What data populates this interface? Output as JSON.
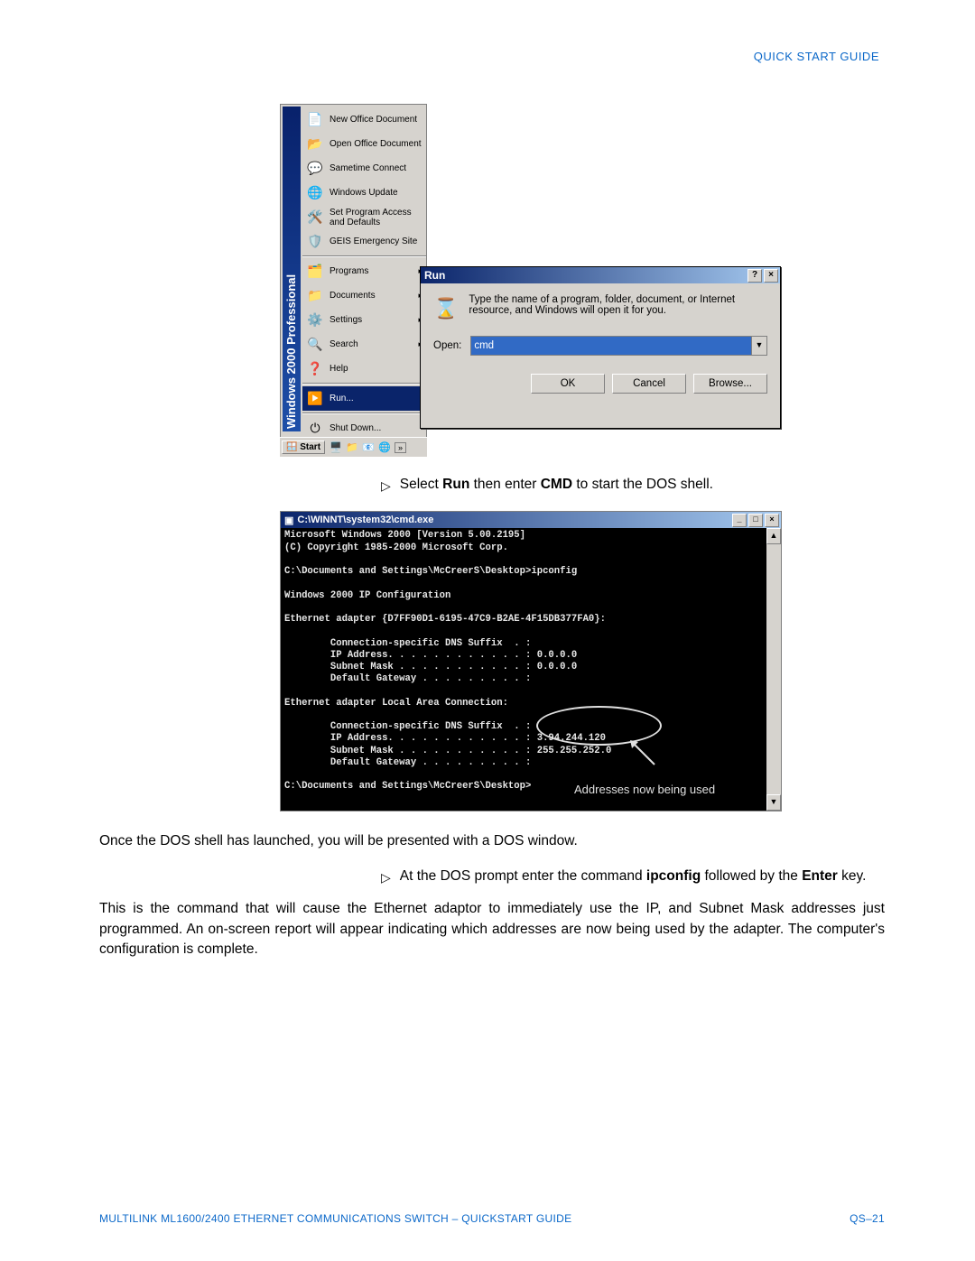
{
  "header": {
    "right": "QUICK START GUIDE"
  },
  "startmenu": {
    "banner": "Windows 2000 Professional",
    "items": [
      {
        "label": "New Office Document",
        "iconName": "new-doc-icon",
        "emoji": "📄"
      },
      {
        "label": "Open Office Document",
        "iconName": "open-doc-icon",
        "emoji": "📂"
      },
      {
        "label": "Sametime Connect",
        "iconName": "sametime-icon",
        "emoji": "💬"
      },
      {
        "label": "Windows Update",
        "iconName": "update-icon",
        "emoji": "🌐"
      },
      {
        "label": "Set Program Access and Defaults",
        "iconName": "access-icon",
        "emoji": "🛠️"
      },
      {
        "label": "GEIS Emergency Site",
        "iconName": "geis-icon",
        "emoji": "🛡️"
      },
      {
        "sep": true
      },
      {
        "label": "Programs",
        "iconName": "programs-icon",
        "emoji": "🗂️",
        "submenu": true
      },
      {
        "label": "Documents",
        "iconName": "documents-icon",
        "emoji": "📁",
        "submenu": true
      },
      {
        "label": "Settings",
        "iconName": "settings-icon",
        "emoji": "⚙️",
        "submenu": true
      },
      {
        "label": "Search",
        "iconName": "search-icon",
        "emoji": "🔍",
        "submenu": true
      },
      {
        "label": "Help",
        "iconName": "help-icon",
        "emoji": "❓"
      },
      {
        "sep": true
      },
      {
        "label": "Run...",
        "iconName": "run-icon",
        "emoji": "▶️",
        "selected": true
      },
      {
        "sep": true
      },
      {
        "label": "Shut Down...",
        "iconName": "shutdown-icon",
        "emoji": "⏻"
      }
    ],
    "taskbar": {
      "start": "Start",
      "more": "»"
    }
  },
  "rundlg": {
    "title": "Run",
    "desc": "Type the name of a program, folder, document, or Internet resource, and Windows will open it for you.",
    "openLabel": "Open:",
    "cmdValue": "cmd",
    "buttons": {
      "ok": "OK",
      "cancel": "Cancel",
      "browse": "Browse..."
    }
  },
  "instr1": {
    "pre": "Select ",
    "b1": "Run",
    "mid": " then enter ",
    "b2": "CMD",
    "post": " to start the DOS shell."
  },
  "cmd": {
    "title": "C:\\WINNT\\system32\\cmd.exe",
    "lines": "Microsoft Windows 2000 [Version 5.00.2195]\n(C) Copyright 1985-2000 Microsoft Corp.\n\nC:\\Documents and Settings\\McCreerS\\Desktop>ipconfig\n\nWindows 2000 IP Configuration\n\nEthernet adapter {D7FF90D1-6195-47C9-B2AE-4F15DB377FA0}:\n\n        Connection-specific DNS Suffix  . :\n        IP Address. . . . . . . . . . . . : 0.0.0.0\n        Subnet Mask . . . . . . . . . . . : 0.0.0.0\n        Default Gateway . . . . . . . . . :\n\nEthernet adapter Local Area Connection:\n\n        Connection-specific DNS Suffix  . :\n        IP Address. . . . . . . . . . . . : 3.94.244.120\n        Subnet Mask . . . . . . . . . . . : 255.255.252.0\n        Default Gateway . . . . . . . . . :\n\nC:\\Documents and Settings\\McCreerS\\Desktop>",
    "annotation": "Addresses now being used"
  },
  "para1": "Once the DOS shell has launched, you will be presented with a DOS window.",
  "instr2": {
    "pre": "At the DOS prompt enter the command ",
    "b1": "ipconfig",
    "mid": " followed by the ",
    "b2": "Enter",
    "post": " key."
  },
  "para2": "This is the command that will cause the Ethernet adaptor to immediately use the IP, and Subnet Mask addresses just programmed. An on-screen report will appear indicating which addresses are now being used by the adapter. The computer's configuration is complete.",
  "footer": {
    "left": "MULTILINK ML1600/2400 ETHERNET COMMUNICATIONS SWITCH – QUICKSTART GUIDE",
    "right": "QS–21"
  }
}
